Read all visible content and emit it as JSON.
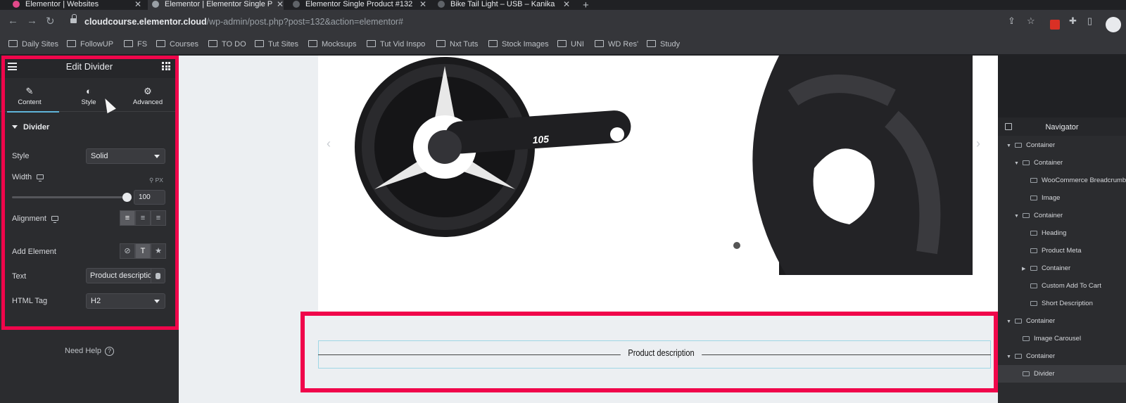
{
  "browser": {
    "tabs": [
      {
        "title": "Elementor | Websites",
        "favicon_color": "#e2498a",
        "active": false
      },
      {
        "title": "Elementor | Elementor Single P",
        "favicon_color": "#9aa0a6",
        "active": true
      },
      {
        "title": "Elementor Single Product #132",
        "favicon_color": "#9aa0a6",
        "active": false
      },
      {
        "title": "Bike Tail Light – USB – Kanika",
        "favicon_color": "#9aa0a6",
        "active": false
      }
    ],
    "url_host": "cloudcourse.elementor.cloud",
    "url_path": "/wp-admin/post.php?post=132&action=elementor#",
    "bookmarks": [
      "Daily Sites",
      "FollowUP",
      "FS",
      "Courses",
      "TO DO",
      "Tut Sites",
      "Mocksups",
      "Tut Vid Inspo",
      "Nxt Tuts",
      "Stock Images",
      "UNI",
      "WD Res'",
      "Study"
    ]
  },
  "panel": {
    "title": "Edit Divider",
    "tabs": [
      {
        "label": "Content",
        "icon": "pencil-icon"
      },
      {
        "label": "Style",
        "icon": "contrast-icon"
      },
      {
        "label": "Advanced",
        "icon": "gear-icon"
      }
    ],
    "section": "Divider",
    "fields": {
      "style_label": "Style",
      "style_value": "Solid",
      "width_label": "Width",
      "width_unit": "PX",
      "width_value": "100",
      "width_fraction": 1.0,
      "alignment_label": "Alignment",
      "add_element_label": "Add Element",
      "text_label": "Text",
      "text_value": "Product descriptio",
      "html_tag_label": "HTML Tag",
      "html_tag_value": "H2"
    },
    "need_help": "Need Help"
  },
  "canvas": {
    "divider_text": "Product description",
    "highlight_color": "#f0064b"
  },
  "navigator": {
    "title": "Navigator",
    "items": [
      {
        "label": "Container",
        "depth": 0,
        "arrow": "down"
      },
      {
        "label": "Container",
        "depth": 1,
        "arrow": "down"
      },
      {
        "label": "WooCommerce Breadcrumbs",
        "depth": 2,
        "arrow": ""
      },
      {
        "label": "Image",
        "depth": 2,
        "arrow": ""
      },
      {
        "label": "Container",
        "depth": 1,
        "arrow": "down"
      },
      {
        "label": "Heading",
        "depth": 2,
        "arrow": ""
      },
      {
        "label": "Product Meta",
        "depth": 2,
        "arrow": ""
      },
      {
        "label": "Container",
        "depth": 2,
        "arrow": "right"
      },
      {
        "label": "Custom Add To Cart",
        "depth": 2,
        "arrow": ""
      },
      {
        "label": "Short Description",
        "depth": 2,
        "arrow": ""
      },
      {
        "label": "Container",
        "depth": 0,
        "arrow": "down"
      },
      {
        "label": "Image Carousel",
        "depth": 1,
        "arrow": ""
      },
      {
        "label": "Container",
        "depth": 0,
        "arrow": "down"
      },
      {
        "label": "Divider",
        "depth": 1,
        "arrow": "",
        "active": true
      }
    ]
  }
}
